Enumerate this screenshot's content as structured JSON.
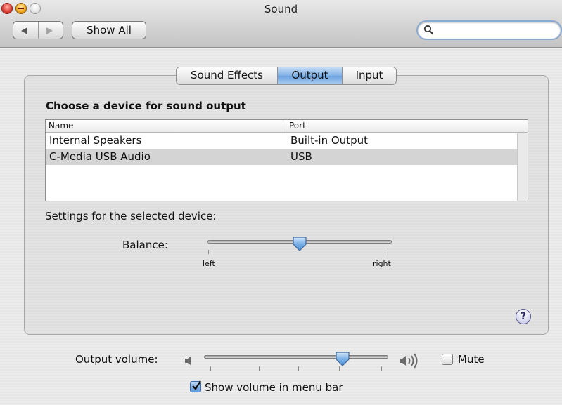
{
  "window": {
    "title": "Sound"
  },
  "toolbar": {
    "show_all_label": "Show All",
    "search_placeholder": ""
  },
  "tabs": [
    {
      "label": "Sound Effects",
      "selected": false
    },
    {
      "label": "Output",
      "selected": true
    },
    {
      "label": "Input",
      "selected": false
    }
  ],
  "output": {
    "heading": "Choose a device for sound output",
    "columns": {
      "name": "Name",
      "port": "Port"
    },
    "devices": [
      {
        "name": "Internal Speakers",
        "port": "Built-in Output",
        "selected": false
      },
      {
        "name": "C-Media USB Audio",
        "port": "USB",
        "selected": true
      }
    ],
    "settings_label": "Settings for the selected device:",
    "balance": {
      "label": "Balance:",
      "left_label": "left",
      "right_label": "right",
      "value": 0.5
    }
  },
  "help": {
    "label": "?"
  },
  "volume": {
    "label": "Output volume:",
    "value": 0.75,
    "mute_label": "Mute",
    "mute_checked": false,
    "show_in_menu_label": "Show volume in menu bar",
    "show_in_menu_checked": true
  },
  "colors": {
    "accent": "#6aa1de",
    "selection": "#d4d4d4"
  }
}
